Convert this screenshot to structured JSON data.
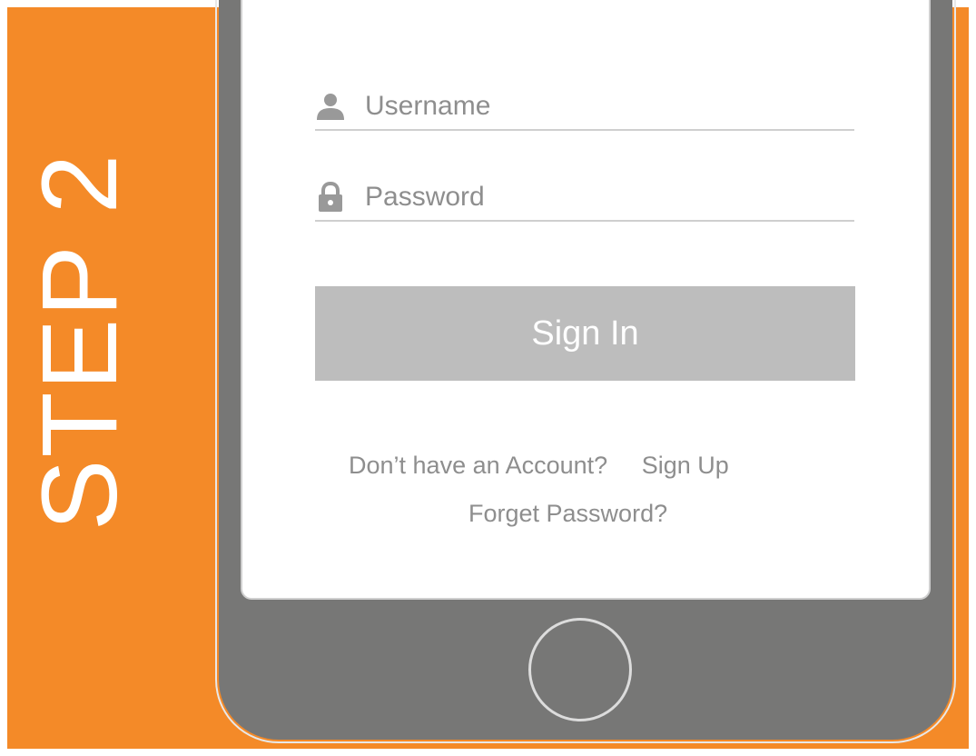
{
  "banner": {
    "step_label": "STEP 2"
  },
  "login_form": {
    "username": {
      "placeholder": "Username",
      "icon": "user-icon"
    },
    "password": {
      "placeholder": "Password",
      "icon": "lock-icon"
    },
    "sign_in_label": "Sign In",
    "no_account_text": "Don’t have an Account?",
    "sign_up_label": "Sign Up",
    "forgot_password_label": "Forget Password?"
  },
  "colors": {
    "background_orange": "#f48a28",
    "phone_gray": "#777776",
    "button_gray": "#bdbdbd",
    "text_gray": "#8e8e8e"
  }
}
